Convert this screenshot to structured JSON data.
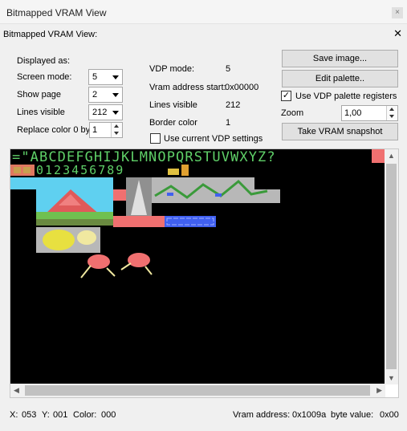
{
  "window": {
    "title": "Bitmapped VRAM View",
    "close_glyph": "×"
  },
  "panel": {
    "title": "Bitmapped VRAM View:",
    "close_glyph": "✕"
  },
  "settings": {
    "displayed_as_label": "Displayed as:",
    "screen_mode_label": "Screen mode:",
    "screen_mode_value": "5",
    "show_page_label": "Show page",
    "show_page_value": "2",
    "lines_visible_label": "Lines visible",
    "lines_visible_value": "212",
    "replace_color_label": "Replace color 0 by",
    "replace_color_value": "1"
  },
  "vdp_info": {
    "vdp_mode_label": "VDP mode:",
    "vdp_mode_value": "5",
    "vram_start_label": "Vram address start:",
    "vram_start_value": "0x00000",
    "lines_visible_label": "Lines visible",
    "lines_visible_value": "212",
    "border_color_label": "Border color",
    "border_color_value": "1",
    "use_current_label": "Use current VDP settings",
    "use_current_checked": false
  },
  "actions": {
    "save_image": "Save image...",
    "edit_palette": "Edit palette..",
    "use_vdp_palette_label": "Use VDP  palette registers",
    "use_vdp_palette_checked": true,
    "zoom_label": "Zoom",
    "zoom_value": "1,00",
    "snapshot": "Take VRAM snapshot"
  },
  "vram_text": {
    "row1": "=\"ABCDEFGHIJKLMNOPQRSTUVWXYZ?",
    "row2": "0123456789"
  },
  "status": {
    "x_label": "X:",
    "x_value": "053",
    "y_label": "Y:",
    "y_value": "001",
    "color_label": "Color:",
    "color_value": "000",
    "vram_address_label": "Vram address:",
    "vram_address_value": "0x1009a",
    "byte_value_label": "byte value:",
    "byte_value_value": "0x00"
  },
  "colors": {
    "vram_bg": "#000000",
    "text_green": "#5fd068",
    "salmon": "#f07070",
    "sky": "#5fd0f0",
    "grey": "#b8b8b8",
    "blue": "#4060f0"
  }
}
